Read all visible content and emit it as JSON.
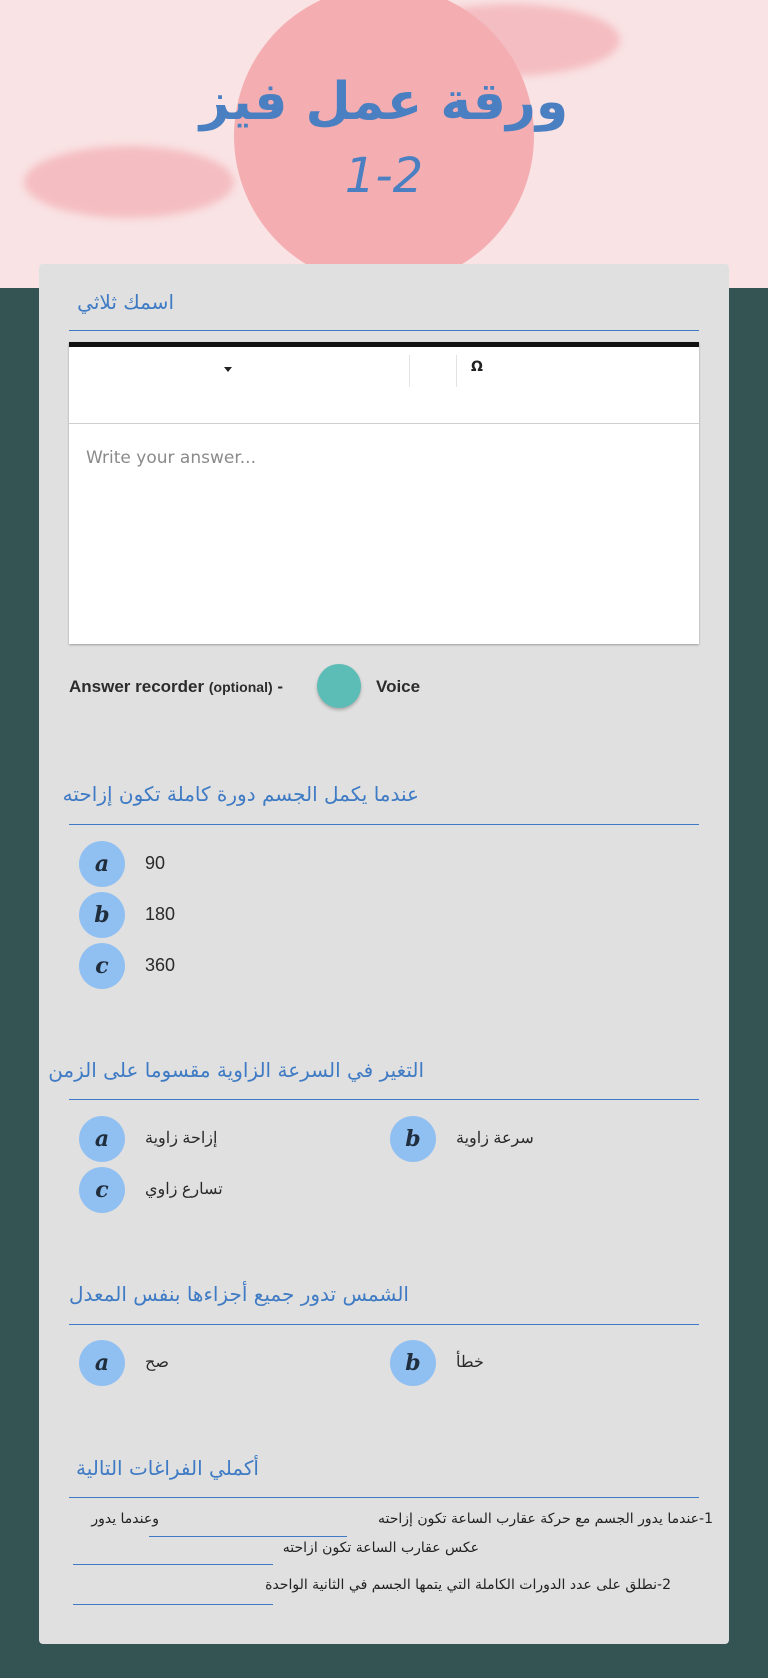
{
  "header": {
    "title_line1": "ورقة عمل فيز",
    "title_line2": "1-2"
  },
  "q1": {
    "title": "اسمك ثلاثي",
    "toolbar_symbol": "Ω",
    "placeholder": "Write your answer...",
    "recorder": {
      "label": "Answer recorder",
      "optional": "(optional)",
      "dash": "-",
      "voice": "Voice"
    }
  },
  "q2": {
    "title": "عندما يكمل الجسم دورة كاملة تكون إزاحته",
    "options": [
      {
        "letter": "a",
        "text": "90"
      },
      {
        "letter": "b",
        "text": "180"
      },
      {
        "letter": "c",
        "text": "360"
      }
    ]
  },
  "q3": {
    "title": "التغير في السرعة الزاوية مقسوما على الزمن",
    "options": [
      {
        "letter": "a",
        "text": "إزاحة زاوية"
      },
      {
        "letter": "b",
        "text": "سرعة زاوية"
      },
      {
        "letter": "c",
        "text": "تسارع زاوي"
      }
    ]
  },
  "q4": {
    "title": "الشمس تدور جميع أجزاءها بنفس المعدل",
    "options": [
      {
        "letter": "a",
        "text": "صح"
      },
      {
        "letter": "b",
        "text": "خطأ"
      }
    ]
  },
  "q5": {
    "title": "أكملي الفراغات التالية",
    "line1a": "1-عندما يدور الجسم مع حركة عقارب الساعة تكون إزاحته",
    "line1b": "وعندما يدور",
    "line2": "عكس عقارب الساعة تكون ازاحته",
    "line3": "2-نطلق على عدد الدورات الكاملة التي يتمها الجسم في الثانية الواحدة"
  }
}
